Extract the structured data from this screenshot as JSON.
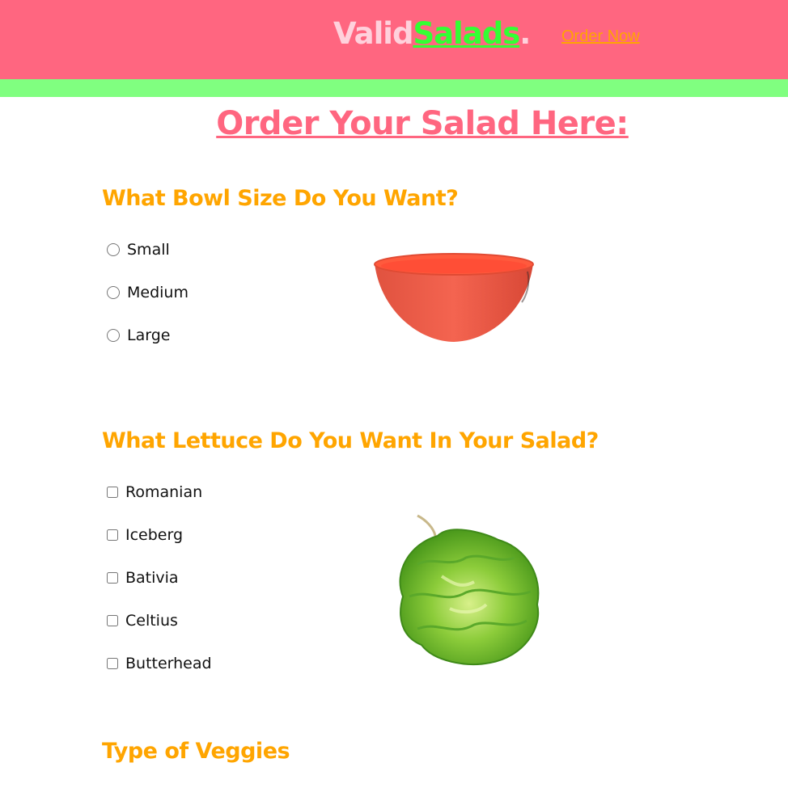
{
  "header": {
    "brand_part1": "Valid",
    "brand_part2": "Salads",
    "brand_part3": ".",
    "order_link": "Order Now"
  },
  "colors": {
    "header_bg": "#ff6680",
    "accent_green": "#80ff80",
    "heading_orange": "#ffa500",
    "title_pink": "#ff6680"
  },
  "main": {
    "title": "Order Your Salad Here:",
    "bowl_section": {
      "heading": "What Bowl Size Do You Want?",
      "options": [
        "Small",
        "Medium",
        "Large"
      ],
      "image_icon": "red-bowl-image"
    },
    "lettuce_section": {
      "heading": "What Lettuce Do You Want In Your Salad?",
      "options": [
        "Romanian",
        "Iceberg",
        "Bativia",
        "Celtius",
        "Butterhead"
      ],
      "image_icon": "lettuce-image"
    },
    "veggies_section": {
      "heading": "Type of Veggies"
    }
  }
}
